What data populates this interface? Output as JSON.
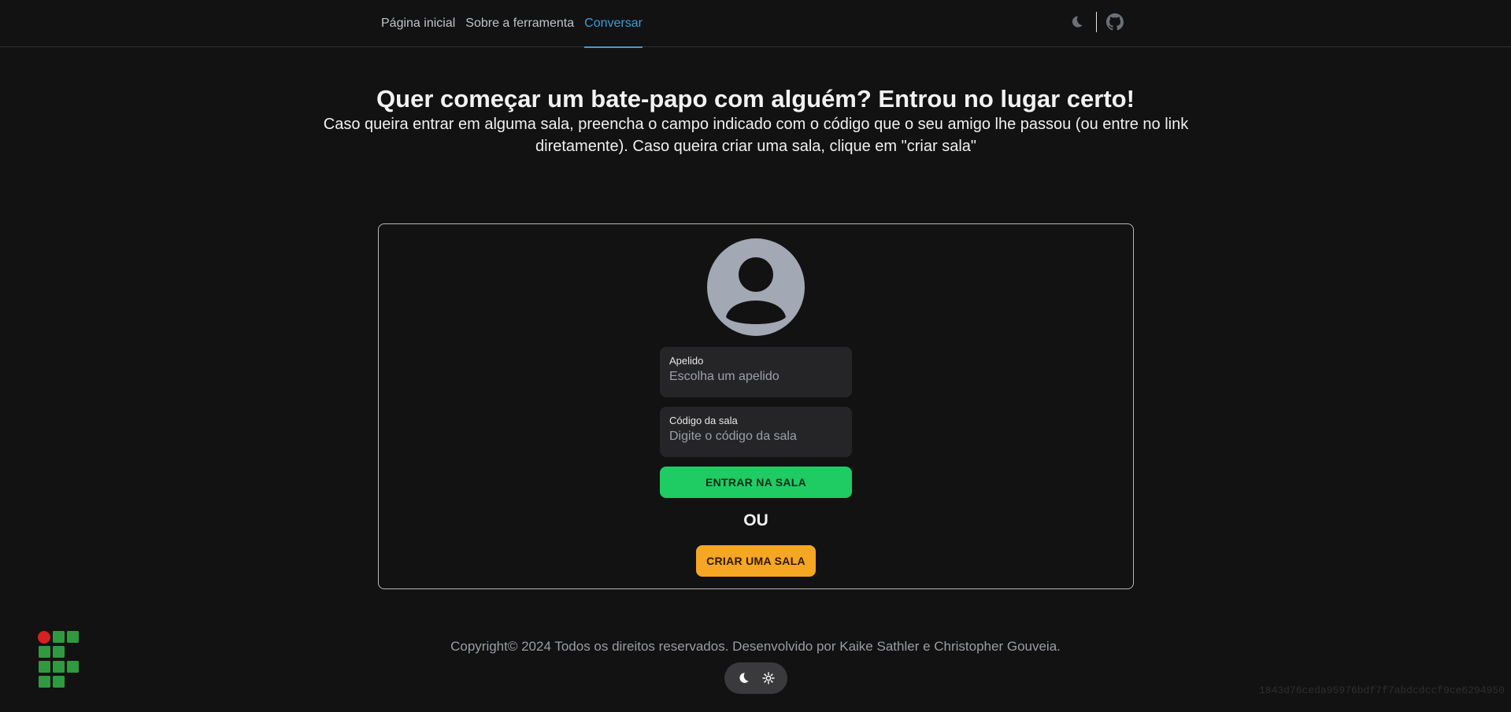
{
  "nav": {
    "links": [
      {
        "label": "Página inicial",
        "active": false
      },
      {
        "label": "Sobre a ferramenta",
        "active": false
      },
      {
        "label": "Conversar",
        "active": true
      }
    ],
    "accent_color": "#3b9ddd"
  },
  "header_icons": {
    "theme": "moon-icon",
    "repo": "github-icon"
  },
  "hero": {
    "title": "Quer começar um bate-papo com alguém? Entrou no lugar certo!",
    "subtitle": "Caso queira entrar em alguma sala, preencha o campo indicado com o código que o seu amigo lhe passou (ou entre no link diretamente). Caso queira criar uma sala, clique em \"criar sala\""
  },
  "form": {
    "nickname": {
      "label": "Apelido",
      "placeholder": "Escolha um apelido",
      "value": ""
    },
    "room_code": {
      "label": "Código da sala",
      "placeholder": "Digite o código da sala",
      "value": ""
    },
    "enter_button": "ENTRAR NA SALA",
    "separator": "OU",
    "create_button": "CRIAR UMA SALA",
    "enter_color": "#1fcc64",
    "create_color": "#f5a623"
  },
  "footer": {
    "copyright": "Copyright© 2024 Todos os direitos reservados. Desenvolvido por Kaike Sathler e Christopher Gouveia.",
    "hash": "1843d76ceda95976bdf7f7abdcdccf9ce6294950",
    "logo_colors": {
      "dot": "#d42121",
      "squares": "#2f9a40"
    }
  }
}
